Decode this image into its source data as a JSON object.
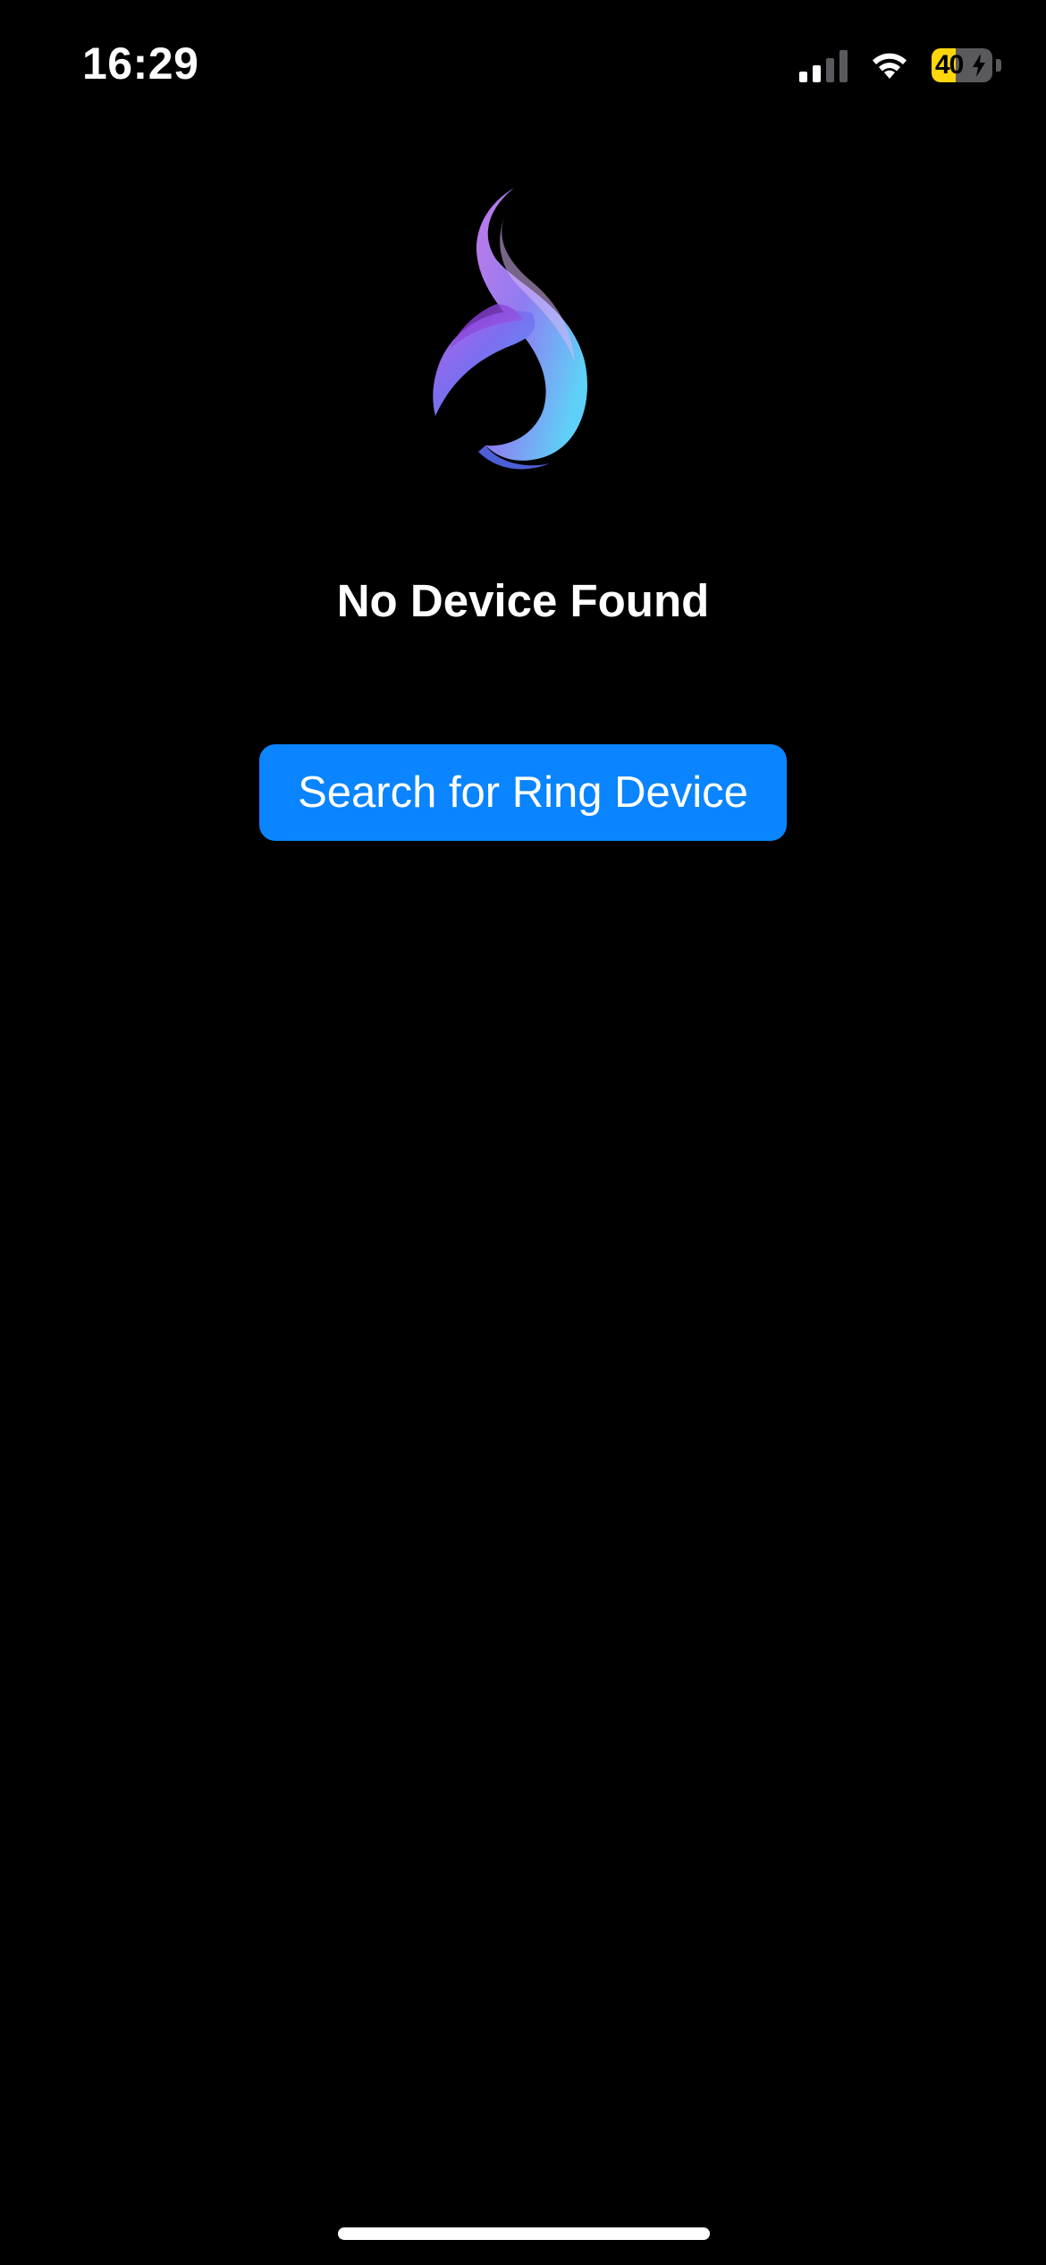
{
  "status_bar": {
    "time": "16:29",
    "signal_bars_active": 2,
    "signal_bars_total": 4,
    "battery_percent": 40,
    "battery_label": "40",
    "battery_charging": true,
    "icons": [
      "cellular-signal-icon",
      "wifi-icon",
      "battery-icon",
      "charging-bolt-icon"
    ]
  },
  "logo": {
    "icon": "app-logo-swirl"
  },
  "main": {
    "title": "No Device Found",
    "search_button_label": "Search for Ring Device"
  },
  "colors": {
    "background": "#000000",
    "text": "#FFFFFF",
    "button": "#0A84FF",
    "battery_fill": "#FFD60A",
    "signal_active": "#FFFFFF",
    "signal_inactive": "#5A5A5E",
    "logo_gradient": [
      "#A45BE8",
      "#6A7CF0",
      "#5FC4F5"
    ]
  }
}
